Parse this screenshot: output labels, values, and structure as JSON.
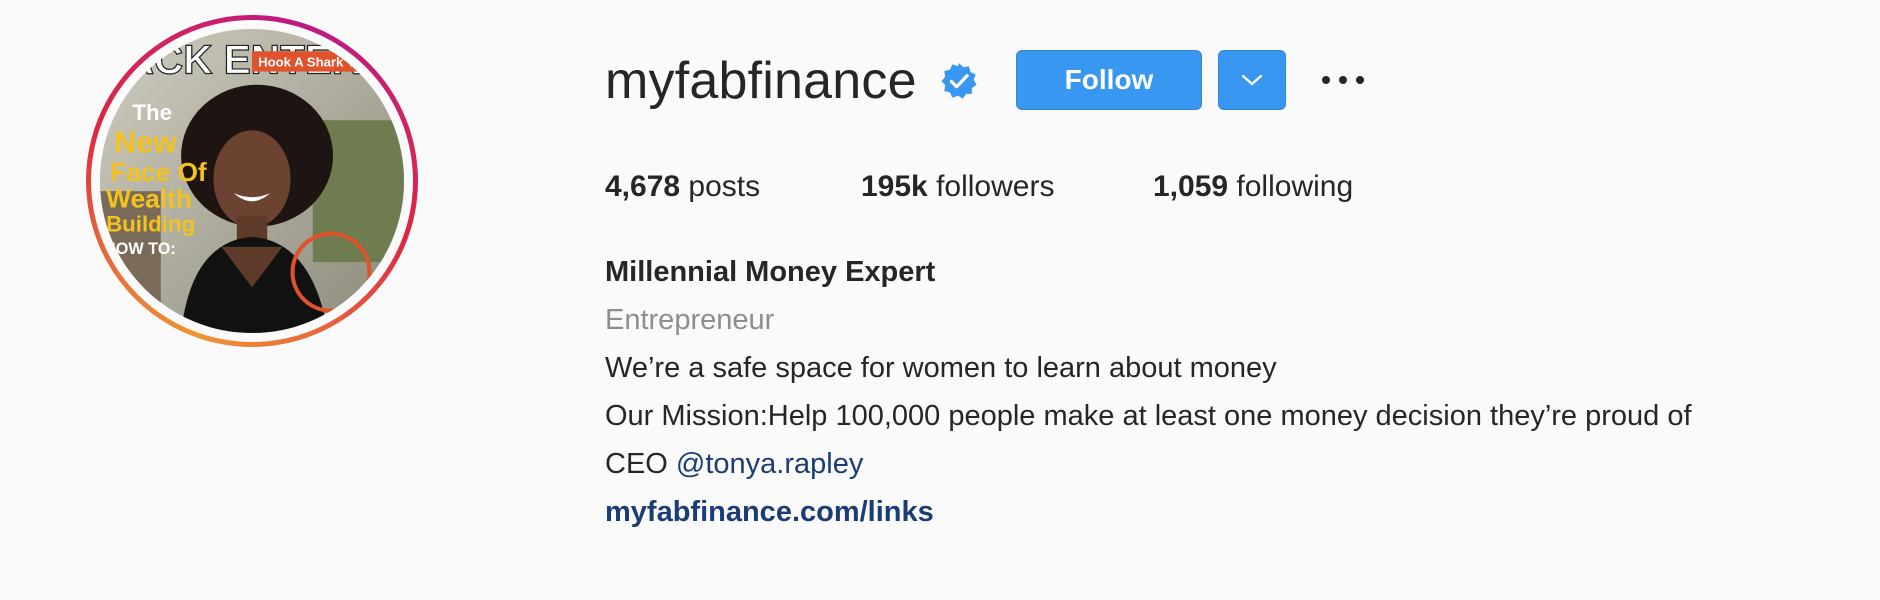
{
  "profile": {
    "username": "myfabfinance",
    "verified": true,
    "follow_label": "Follow",
    "more_label": "•••",
    "accent_color": "#3897f0"
  },
  "avatar": {
    "cover_title": "LACK ENTERPRIS",
    "cover_badge": "Hook A Shark T",
    "cover_headline_1": "The",
    "cover_headline_2": "New",
    "cover_headline_3": "Face Of",
    "cover_headline_4": "Wealth",
    "cover_headline_5": "Building",
    "cover_howto": "HOW TO:"
  },
  "stats": {
    "posts_count": "4,678",
    "posts_label": " posts",
    "followers_count": "195k",
    "followers_label": " followers",
    "following_count": "1,059",
    "following_label": " following"
  },
  "bio": {
    "full_name": "Millennial Money Expert",
    "category": "Entrepreneur",
    "line1": "We’re a safe space for women to learn about money",
    "line2": "Our Mission:Help 100,000 people make at least one money decision they’re proud of",
    "line3_prefix": "CEO ",
    "line3_mention": "@tonya.rapley",
    "website": "myfabfinance.com/links"
  }
}
